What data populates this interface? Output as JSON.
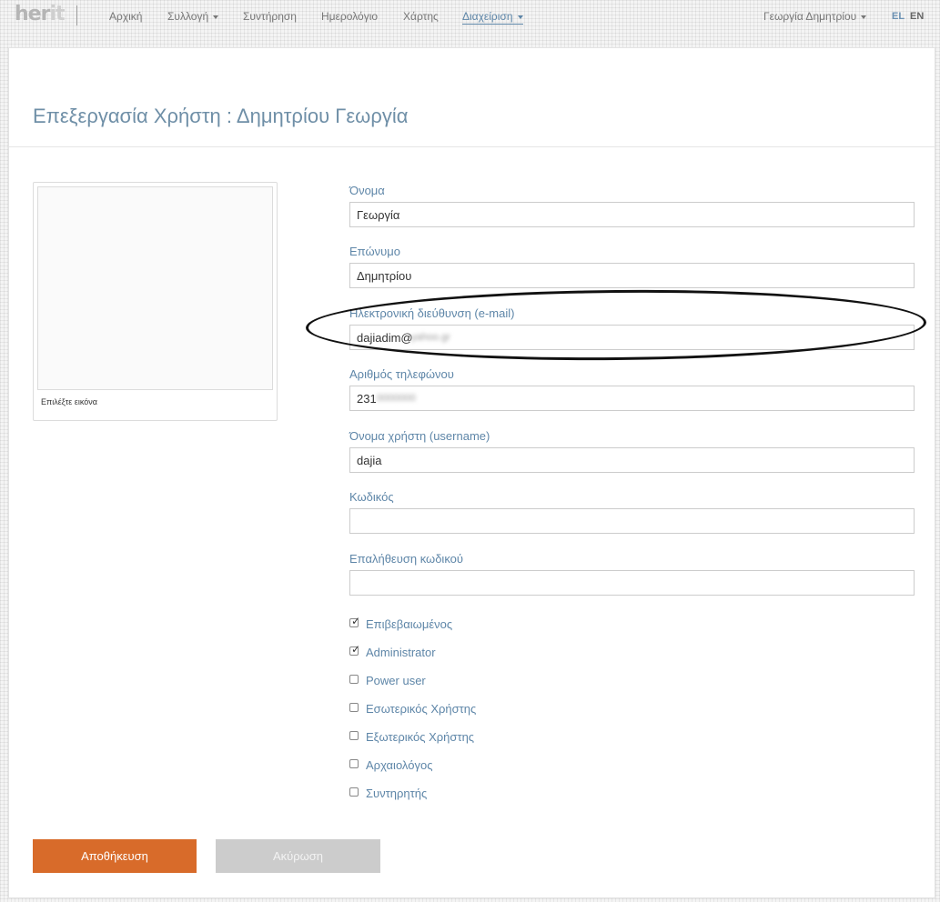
{
  "nav": {
    "logo_main": "her",
    "logo_tail": "it",
    "items": [
      "Αρχική",
      "Συλλογή",
      "Συντήρηση",
      "Ημερολόγιο",
      "Χάρτης",
      "Διαχείριση"
    ],
    "user_name": "Γεωργία Δημητρίου",
    "lang_el": "EL",
    "lang_en": "EN"
  },
  "page": {
    "title": "Επεξεργασία Χρήστη : Δημητρίου Γεωργία"
  },
  "avatar": {
    "caption": "Επιλέξτε εικόνα"
  },
  "form": {
    "first_name_label": "Όνομα",
    "first_name_value": "Γεωργία",
    "last_name_label": "Επώνυμο",
    "last_name_value": "Δημητρίου",
    "email_label": "Ηλεκτρονική διεύθυνση (e-mail)",
    "email_value": "dajiadim@",
    "email_obscured": "yahoo.gr",
    "phone_label": "Αριθμός τηλεφώνου",
    "phone_value": "231",
    "phone_obscured": "0000000",
    "username_label": "Όνομα χρήστη (username)",
    "username_value": "dajia",
    "password_label": "Κωδικός",
    "password_value": "",
    "password_confirm_label": "Επαλήθευση κωδικού",
    "password_confirm_value": ""
  },
  "roles": [
    {
      "label": "Επιβεβαιωμένος",
      "checked": true
    },
    {
      "label": "Administrator",
      "checked": true
    },
    {
      "label": "Power user",
      "checked": false
    },
    {
      "label": "Εσωτερικός Χρήστης",
      "checked": false
    },
    {
      "label": "Εξωτερικός Χρήστης",
      "checked": false
    },
    {
      "label": "Αρχαιολόγος",
      "checked": false
    },
    {
      "label": "Συντηρητής",
      "checked": false
    }
  ],
  "actions": {
    "save_label": "Αποθήκευση",
    "cancel_label": "Ακύρωση"
  },
  "colors": {
    "accent": "#5e86a8",
    "save_button": "#d86b2a",
    "cancel_button": "#cccccc"
  }
}
